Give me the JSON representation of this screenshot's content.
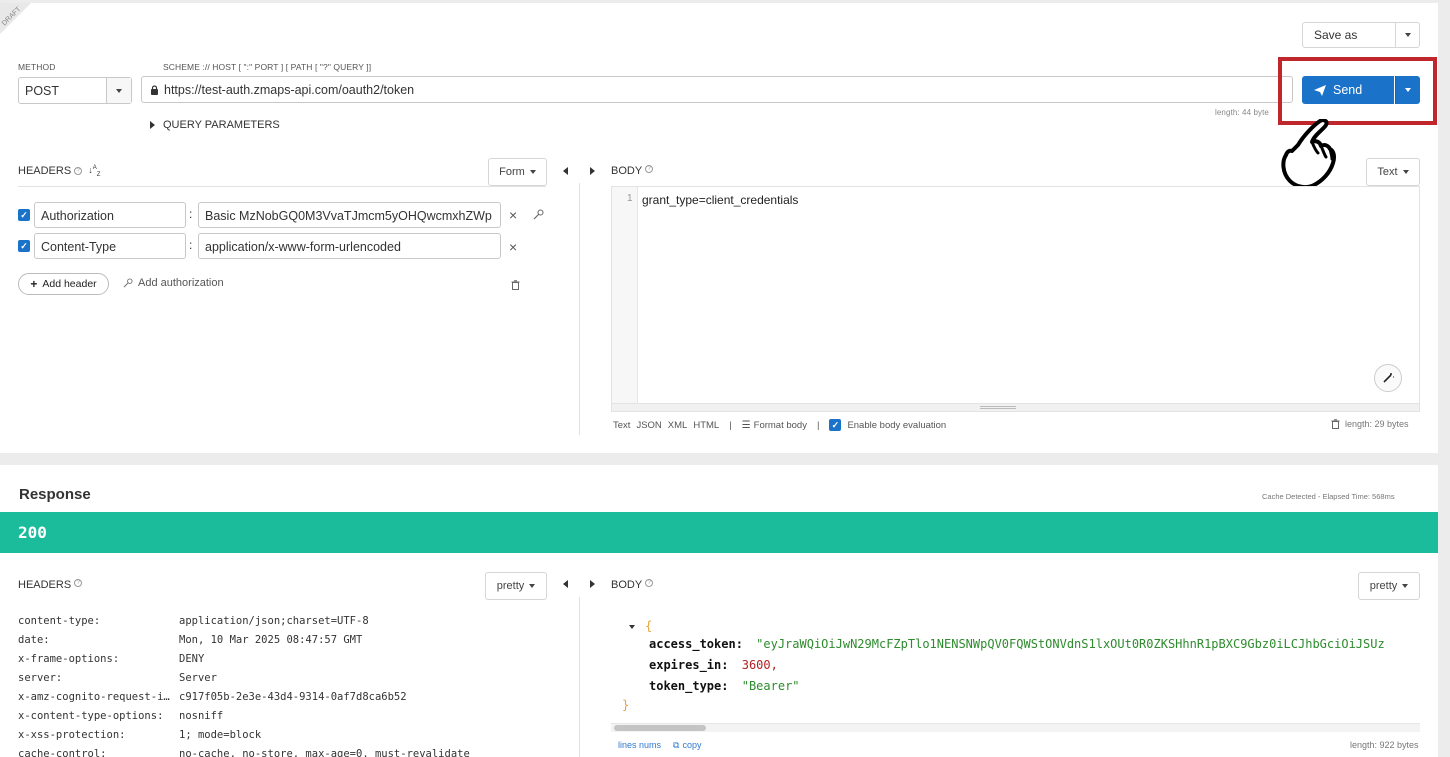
{
  "draft_label": "DRAFT",
  "save_as": {
    "label": "Save as"
  },
  "method": {
    "label": "METHOD",
    "value": "POST"
  },
  "url": {
    "label": "SCHEME :// HOST [ \":\" PORT ] [ PATH [ \"?\" QUERY ]]",
    "value": "https://test-auth.zmaps-api.com/oauth2/token",
    "length": "length: 44 byte"
  },
  "send": {
    "label": "Send"
  },
  "query_params_label": "QUERY PARAMETERS",
  "request_headers": {
    "title": "HEADERS",
    "mode": "Form",
    "rows": [
      {
        "name": "Authorization",
        "value": "Basic MzNobGQ0M3VvaTJmcm5yOHQwcmxhZWp"
      },
      {
        "name": "Content-Type",
        "value": "application/x-www-form-urlencoded"
      }
    ],
    "add_header": "Add header",
    "add_authorization": "Add authorization"
  },
  "request_body": {
    "title": "BODY",
    "mode": "Text",
    "line_number": "1",
    "content": "grant_type=client_credentials",
    "footer": {
      "formats": [
        "Text",
        "JSON",
        "XML",
        "HTML"
      ],
      "format_body": "Format body",
      "enable_eval": "Enable body evaluation",
      "length": "length: 29 bytes"
    }
  },
  "response": {
    "title": "Response",
    "meta": "Cache Detected - Elapsed Time: 568ms",
    "status": "200",
    "status_color": "#1abc9c",
    "headers": {
      "title": "HEADERS",
      "mode": "pretty",
      "rows": [
        {
          "key": "content-type:",
          "value": "application/json;charset=UTF-8"
        },
        {
          "key": "date:",
          "value": "Mon, 10 Mar 2025 08:47:57 GMT"
        },
        {
          "key": "x-frame-options:",
          "value": "DENY"
        },
        {
          "key": "server:",
          "value": "Server"
        },
        {
          "key": "x-amz-cognito-request-i…",
          "value": "c917f05b-2e3e-43d4-9314-0af7d8ca6b52"
        },
        {
          "key": "x-content-type-options:",
          "value": "nosniff"
        },
        {
          "key": "x-xss-protection:",
          "value": "1; mode=block"
        },
        {
          "key": "cache-control:",
          "value": "no-cache, no-store, max-age=0, must-revalidate"
        }
      ]
    },
    "body": {
      "title": "BODY",
      "mode": "pretty",
      "open_brace": "{",
      "close_brace": "}",
      "fields": [
        {
          "key": "access_token:",
          "value": "\"eyJraWQiOiJwN29McFZpTlo1NENSNWpQV0FQWStONVdnS1lxOUt0R0ZKSHhnR1pBXC9Gbz0iLCJhbGciOiJSUz"
        },
        {
          "key": "expires_in:",
          "value": "3600,"
        },
        {
          "key": "token_type:",
          "value": "\"Bearer\""
        }
      ],
      "lines_nums": "lines nums",
      "copy": "copy",
      "length": "length: 922 bytes"
    }
  },
  "colors": {
    "accent": "#1a73c9",
    "highlight": "#c0272d",
    "status_ok": "#1abc9c"
  }
}
